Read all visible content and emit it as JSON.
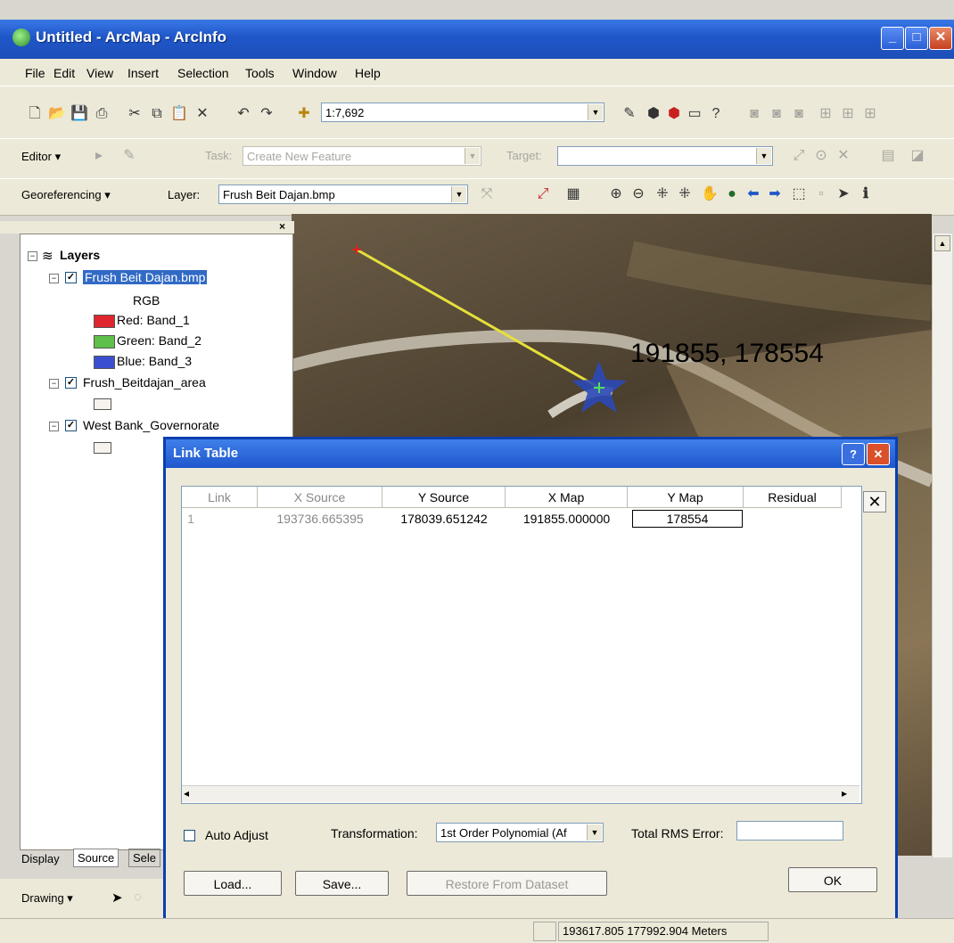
{
  "window": {
    "title": "Untitled - ArcMap - ArcInfo"
  },
  "menu": [
    "File",
    "Edit",
    "View",
    "Insert",
    "Selection",
    "Tools",
    "Window",
    "Help"
  ],
  "standard_toolbar": {
    "scale": "1:7,692"
  },
  "editor_toolbar": {
    "editor_label": "Editor",
    "task_label": "Task:",
    "task_value": "Create New Feature",
    "target_label": "Target:"
  },
  "georef_toolbar": {
    "georef_label": "Georeferencing",
    "layer_label": "Layer:",
    "layer_value": "Frush Beit  Dajan.bmp"
  },
  "toc": {
    "root": "Layers",
    "layer1": "Frush Beit Dajan.bmp",
    "rgb": "RGB",
    "red": "Red:  Band_1",
    "green": "Green: Band_2",
    "blue": "Blue:  Band_3",
    "layer2": "Frush_Beitdajan_area",
    "layer3": "West Bank_Governorate",
    "tabs": [
      "Display",
      "Source",
      "Sele"
    ],
    "colors": {
      "red": "#e0252e",
      "green": "#5ec04a",
      "blue": "#3a4fd0"
    }
  },
  "map": {
    "coord_label": "191855, 178554"
  },
  "link_table": {
    "title": "Link Table",
    "columns": [
      "Link",
      "X Source",
      "Y Source",
      "X Map",
      "Y Map",
      "Residual"
    ],
    "rows": [
      {
        "link": "1",
        "x_source": "193736.665395",
        "y_source": "178039.651242",
        "x_map": "191855.000000",
        "y_map": "178554",
        "residual": ""
      }
    ],
    "auto_adjust": "Auto Adjust",
    "transformation_label": "Transformation:",
    "transformation_value": "1st Order Polynomial (Af",
    "rms_label": "Total RMS Error:",
    "rms_value": "",
    "load": "Load...",
    "save": "Save...",
    "restore": "Restore From Dataset",
    "ok": "OK"
  },
  "drawing_toolbar": {
    "label": "Drawing"
  },
  "status": {
    "coords": "193617.805  177992.904 Meters"
  }
}
